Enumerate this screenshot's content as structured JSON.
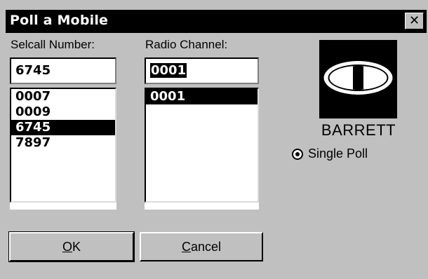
{
  "window": {
    "title": "Poll a Mobile",
    "close_glyph": "✕"
  },
  "selcall": {
    "label": "Selcall Number:",
    "value": "6745",
    "items": [
      "0007",
      "0009",
      "6745",
      "7897"
    ],
    "selected_index": 2
  },
  "channel": {
    "label": "Radio Channel:",
    "value": "0001",
    "items": [
      "0001"
    ],
    "selected_index": 0
  },
  "logo": {
    "icon": "barrett-logo-icon",
    "brand": "BARRETT"
  },
  "poll_mode": {
    "label": "Single Poll",
    "checked": true
  },
  "buttons": {
    "ok_accel": "O",
    "ok_rest": "K",
    "cancel_accel": "C",
    "cancel_rest": "ancel"
  },
  "colors": {
    "dialog_bg": "#c0c0c0",
    "titlebar": "#000000",
    "selection": "#000000"
  }
}
